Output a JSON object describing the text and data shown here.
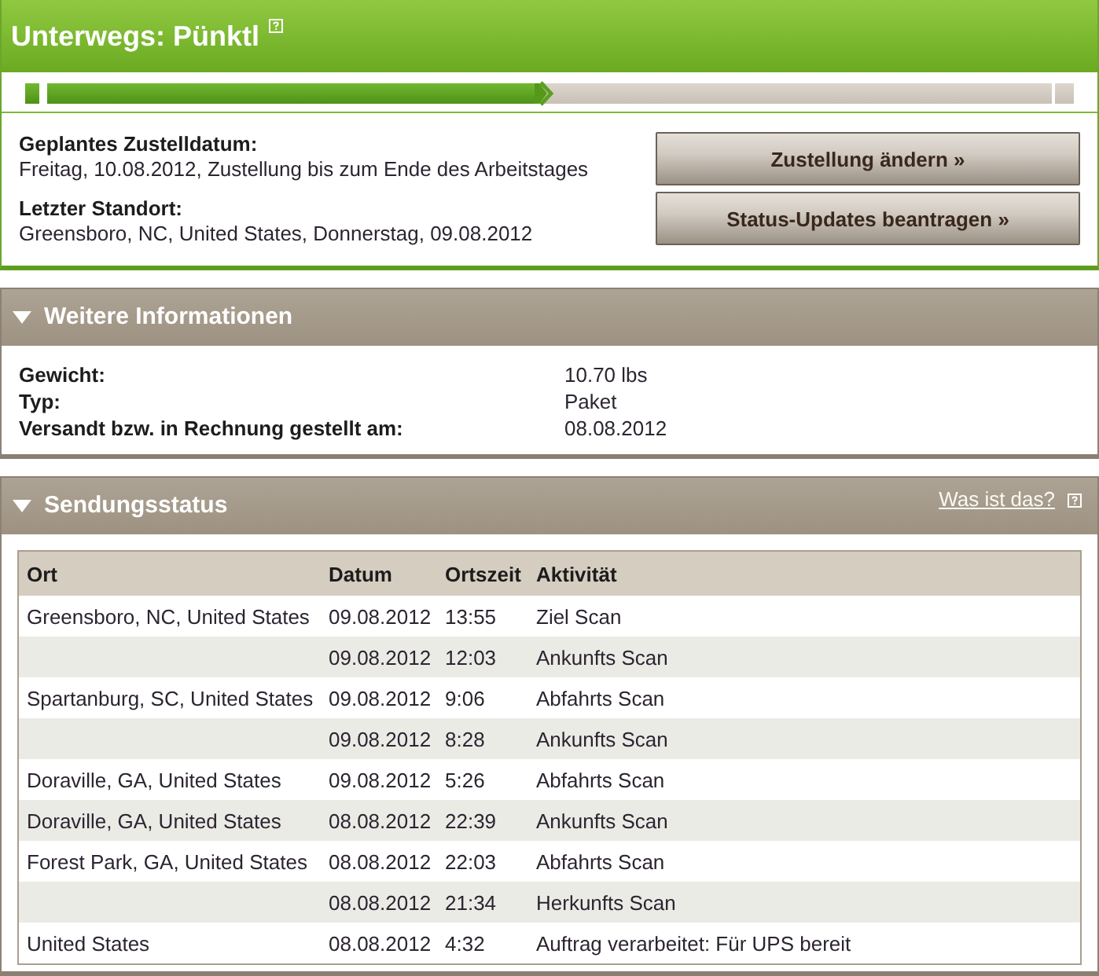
{
  "status_panel": {
    "title": "Unterwegs: Pünktl",
    "progress": {
      "level": 0.49
    },
    "details": [
      {
        "label": "Geplantes Zustelldatum:",
        "value": "Freitag, 10.08.2012, Zustellung bis zum Ende des Arbeitstages"
      },
      {
        "label": "Letzter Standort:",
        "value": "Greensboro, NC, United States, Donnerstag, 09.08.2012"
      }
    ],
    "buttons": [
      "Zustellung ändern »",
      "Status-Updates beantragen »"
    ]
  },
  "more_info": {
    "title": "Weitere Informationen",
    "expanded": true,
    "rows": [
      {
        "label": "Gewicht:",
        "value": "10.70 lbs"
      },
      {
        "label": "Typ:",
        "value": "Paket"
      },
      {
        "label": "Versandt bzw. in Rechnung gestellt am:",
        "value": "08.08.2012"
      }
    ]
  },
  "shipment_status": {
    "title": "Sendungsstatus",
    "expanded": true,
    "help_link": "Was ist das?",
    "table": {
      "columns": [
        "Ort",
        "Datum",
        "Ortszeit",
        "Aktivität"
      ],
      "rows": [
        {
          "location": "Greensboro, NC, United States",
          "date": "09.08.2012",
          "time": "13:55",
          "activity": "Ziel Scan"
        },
        {
          "date": "09.08.2012",
          "time": "12:03",
          "activity": "Ankunfts Scan"
        },
        {
          "location": "Spartanburg, SC, United States",
          "date": "09.08.2012",
          "time": "9:06",
          "activity": "Abfahrts Scan"
        },
        {
          "date": "09.08.2012",
          "time": "8:28",
          "activity": "Ankunfts Scan"
        },
        {
          "location": "Doraville, GA, United States",
          "date": "09.08.2012",
          "time": "5:26",
          "activity": "Abfahrts Scan"
        },
        {
          "location": "Doraville, GA, United States",
          "date": "08.08.2012",
          "time": "22:39",
          "activity": "Ankunfts Scan"
        },
        {
          "location": "Forest Park, GA, United States",
          "date": "08.08.2012",
          "time": "22:03",
          "activity": "Abfahrts Scan"
        },
        {
          "date": "08.08.2012",
          "time": "21:34",
          "activity": "Herkunfts Scan"
        },
        {
          "location": "United States",
          "date": "08.08.2012",
          "time": "4:32",
          "activity": "Auftrag verarbeitet: Für UPS bereit"
        }
      ]
    }
  }
}
